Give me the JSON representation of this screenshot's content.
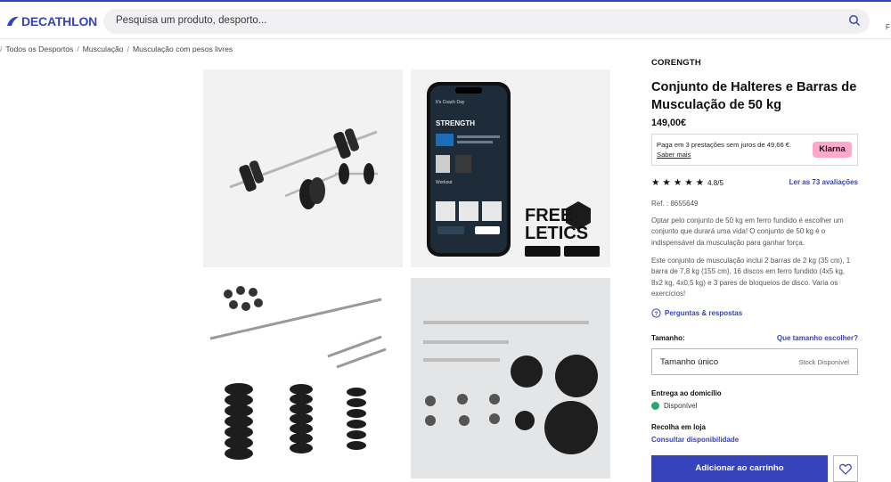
{
  "header": {
    "logo_text": "DECATHLON",
    "search_placeholder": "Pesquisa um produto, desporto...",
    "edge_text": "F"
  },
  "breadcrumb": [
    "Todos os Desportos",
    "Musculação",
    "Musculação com pesos livres"
  ],
  "breadcrumb_lead": "/",
  "gallery": {
    "images": [
      {
        "icon": "barbell-set-photo"
      },
      {
        "icon": "freeletics-app-photo",
        "app_title": "It's Coach Day",
        "app_header": "STRENGTH",
        "app_section": "Workout",
        "logo_line1": "FREE",
        "logo_line2": "LETICS"
      },
      {
        "icon": "dimensions-diagram"
      },
      {
        "icon": "parts-laid-out-photo"
      }
    ]
  },
  "product": {
    "brand": "CORENGTH",
    "title": "Conjunto de Halteres e Barras de Musculação de 50 kg",
    "price": "149,00€",
    "klarna": {
      "text": "Paga em 3 prestações sem juros de 49,66 €.",
      "link": "Saber mais",
      "badge": "Klarna"
    },
    "rating": {
      "value": 4.8,
      "label": "4.8/5",
      "stars": 5,
      "reviews_link": "Ler as 73 avaliações"
    },
    "ref": "Ref. : 8655649",
    "description_1": "Optar pelo conjunto de 50 kg em ferro fundido é escolher um conjunto que durará uma vida! O conjunto de 50 kg é o indispensável da musculação para ganhar força.",
    "description_2": "Este conjunto de musculação inclui 2 barras de 2 kg (35 cm), 1 barra de 7,8 kg (155 cm), 16 discos em ferro fundido (4x5 kg, 8x2 kg, 4x0,5 kg) e 3 pares de bloqueios de disco. Varia os exercícios!",
    "qa_link": "Perguntas & respostas",
    "size": {
      "label": "Tamanho:",
      "help": "Que tamanho escolher?",
      "selected": "Tamanho único",
      "stock": "Stock Disponível"
    },
    "delivery": {
      "label": "Entrega ao domicílio",
      "status": "Disponível",
      "status_color": "#29a86e"
    },
    "pickup": {
      "label": "Recolha em loja",
      "link": "Consultar disponibilidade"
    },
    "add_to_cart": "Adicionar ao carrinho"
  },
  "colors": {
    "brand": "#3643ba",
    "klarna": "#ffa8cd"
  }
}
